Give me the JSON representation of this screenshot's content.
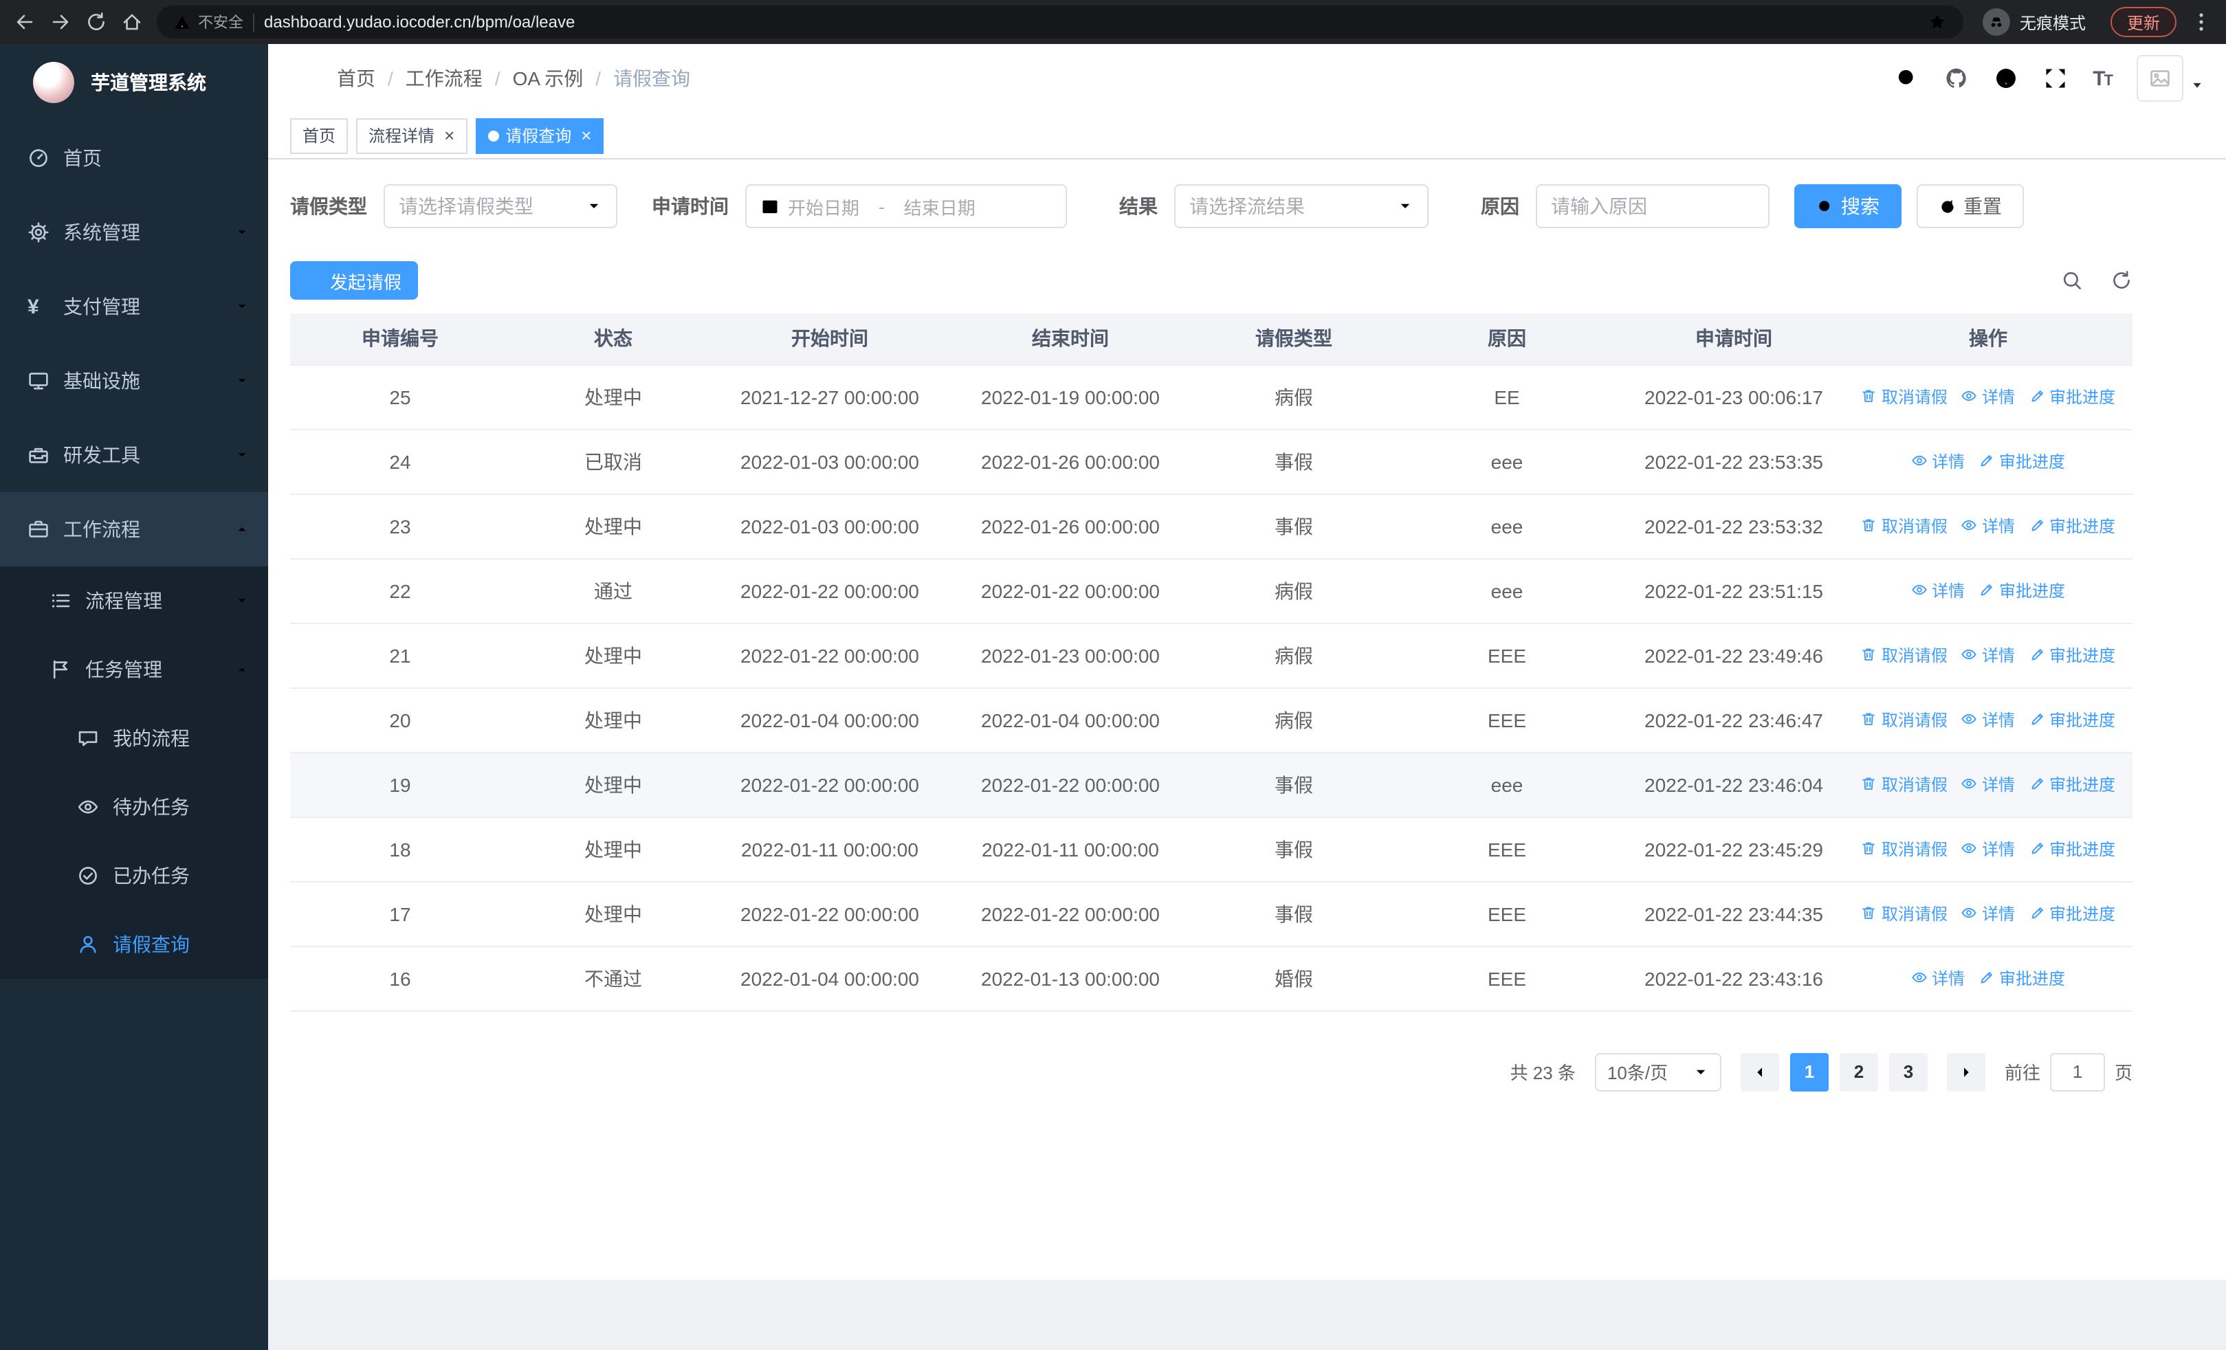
{
  "browser": {
    "security_chip": "不安全",
    "url": "dashboard.yudao.iocoder.cn/bpm/oa/leave",
    "incognito_label": "无痕模式",
    "update_button": "更新"
  },
  "sidebar": {
    "title": "芋道管理系统",
    "menu": {
      "home": "首页",
      "system": "系统管理",
      "payment": "支付管理",
      "infra": "基础设施",
      "devtools": "研发工具",
      "workflow": "工作流程",
      "process_mgmt": "流程管理",
      "task_mgmt": "任务管理",
      "my_process": "我的流程",
      "todo_tasks": "待办任务",
      "done_tasks": "已办任务",
      "leave_query": "请假查询"
    }
  },
  "navbar": {
    "breadcrumb": {
      "home": "首页",
      "workflow": "工作流程",
      "oa": "OA 示例",
      "current": "请假查询"
    }
  },
  "tabs": {
    "home": "首页",
    "process_detail": "流程详情",
    "leave_query": "请假查询"
  },
  "filters": {
    "leave_type_label": "请假类型",
    "leave_type_placeholder": "请选择请假类型",
    "apply_time_label": "申请时间",
    "start_date_placeholder": "开始日期",
    "range_separator": "-",
    "end_date_placeholder": "结束日期",
    "result_label": "结果",
    "result_placeholder": "请选择流结果",
    "reason_label": "原因",
    "reason_placeholder": "请输入原因",
    "search_button": "搜索",
    "reset_button": "重置"
  },
  "toolbar": {
    "create_button": "发起请假"
  },
  "table": {
    "headers": [
      "申请编号",
      "状态",
      "开始时间",
      "结束时间",
      "请假类型",
      "原因",
      "申请时间",
      "操作"
    ],
    "actions": {
      "cancel": "取消请假",
      "detail": "详情",
      "progress": "审批进度"
    },
    "rows": [
      {
        "id": "25",
        "status": "处理中",
        "start": "2021-12-27 00:00:00",
        "end": "2022-01-19 00:00:00",
        "type": "病假",
        "reason": "EE",
        "apply_time": "2022-01-23 00:06:17",
        "can_cancel": true,
        "highlight": false
      },
      {
        "id": "24",
        "status": "已取消",
        "start": "2022-01-03 00:00:00",
        "end": "2022-01-26 00:00:00",
        "type": "事假",
        "reason": "eee",
        "apply_time": "2022-01-22 23:53:35",
        "can_cancel": false,
        "highlight": false
      },
      {
        "id": "23",
        "status": "处理中",
        "start": "2022-01-03 00:00:00",
        "end": "2022-01-26 00:00:00",
        "type": "事假",
        "reason": "eee",
        "apply_time": "2022-01-22 23:53:32",
        "can_cancel": true,
        "highlight": false
      },
      {
        "id": "22",
        "status": "通过",
        "start": "2022-01-22 00:00:00",
        "end": "2022-01-22 00:00:00",
        "type": "病假",
        "reason": "eee",
        "apply_time": "2022-01-22 23:51:15",
        "can_cancel": false,
        "highlight": false
      },
      {
        "id": "21",
        "status": "处理中",
        "start": "2022-01-22 00:00:00",
        "end": "2022-01-23 00:00:00",
        "type": "病假",
        "reason": "EEE",
        "apply_time": "2022-01-22 23:49:46",
        "can_cancel": true,
        "highlight": false
      },
      {
        "id": "20",
        "status": "处理中",
        "start": "2022-01-04 00:00:00",
        "end": "2022-01-04 00:00:00",
        "type": "病假",
        "reason": "EEE",
        "apply_time": "2022-01-22 23:46:47",
        "can_cancel": true,
        "highlight": false
      },
      {
        "id": "19",
        "status": "处理中",
        "start": "2022-01-22 00:00:00",
        "end": "2022-01-22 00:00:00",
        "type": "事假",
        "reason": "eee",
        "apply_time": "2022-01-22 23:46:04",
        "can_cancel": true,
        "highlight": true
      },
      {
        "id": "18",
        "status": "处理中",
        "start": "2022-01-11 00:00:00",
        "end": "2022-01-11 00:00:00",
        "type": "事假",
        "reason": "EEE",
        "apply_time": "2022-01-22 23:45:29",
        "can_cancel": true,
        "highlight": false
      },
      {
        "id": "17",
        "status": "处理中",
        "start": "2022-01-22 00:00:00",
        "end": "2022-01-22 00:00:00",
        "type": "事假",
        "reason": "EEE",
        "apply_time": "2022-01-22 23:44:35",
        "can_cancel": true,
        "highlight": false
      },
      {
        "id": "16",
        "status": "不通过",
        "start": "2022-01-04 00:00:00",
        "end": "2022-01-13 00:00:00",
        "type": "婚假",
        "reason": "EEE",
        "apply_time": "2022-01-22 23:43:16",
        "can_cancel": false,
        "highlight": false
      }
    ]
  },
  "pagination": {
    "total": "共 23 条",
    "page_size": "10条/页",
    "pages": [
      "1",
      "2",
      "3"
    ],
    "goto_label": "前往",
    "goto_value": "1",
    "unit": "页"
  }
}
